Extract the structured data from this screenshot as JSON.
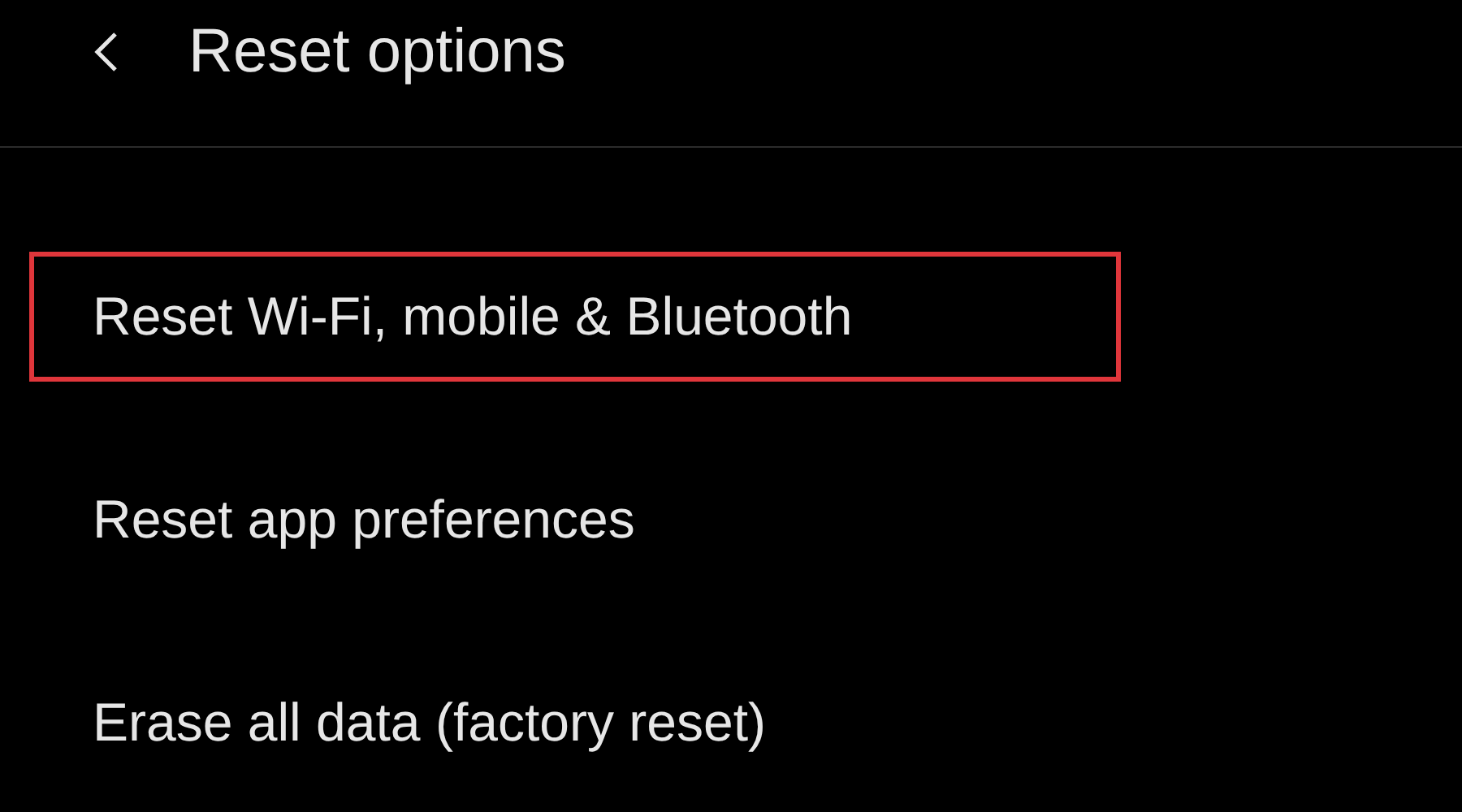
{
  "header": {
    "title": "Reset options"
  },
  "items": [
    {
      "label": "Reset Wi-Fi, mobile & Bluetooth",
      "highlighted": true
    },
    {
      "label": "Reset app preferences",
      "highlighted": false
    },
    {
      "label": "Erase all data (factory reset)",
      "highlighted": false
    }
  ]
}
